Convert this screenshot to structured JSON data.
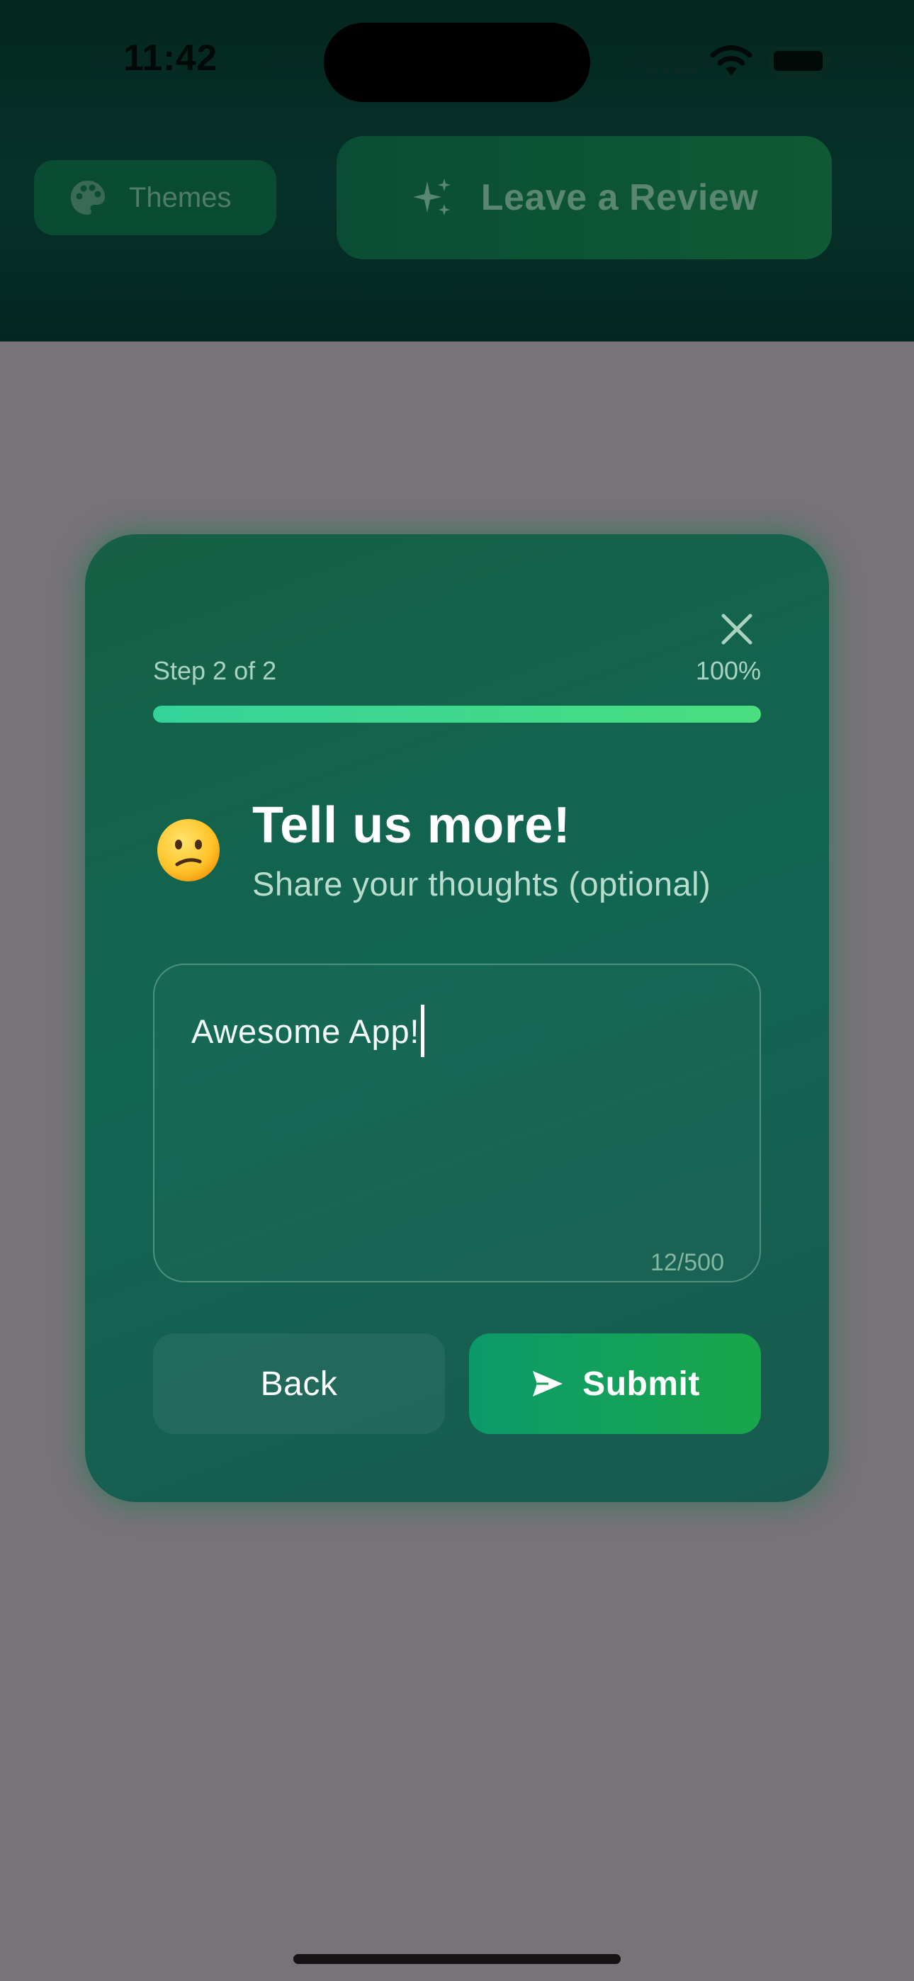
{
  "status_bar": {
    "time": "11:42"
  },
  "header": {
    "themes_label": "Themes",
    "review_label": "Leave a Review"
  },
  "modal": {
    "step_label": "Step 2 of 2",
    "percent_label": "100%",
    "progress_fraction": 1.0,
    "emoji": "confused-face",
    "title": "Tell us more!",
    "subtitle": "Share your thoughts (optional)",
    "feedback_value": "Awesome App!",
    "char_count": "12/500",
    "back_label": "Back",
    "submit_label": "Submit"
  },
  "colors": {
    "overlay": "#787378",
    "accent_green": "#19a64a",
    "progress_fill": "#4ade80"
  }
}
